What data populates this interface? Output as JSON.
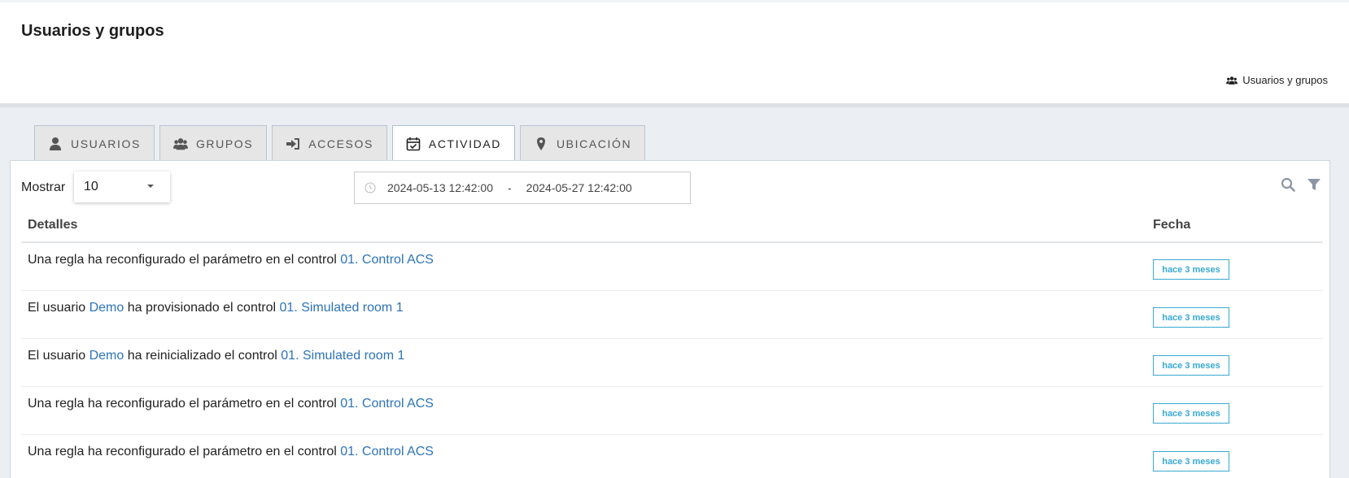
{
  "page": {
    "title": "Usuarios y grupos",
    "breadcrumb": "Usuarios y grupos"
  },
  "tabs": [
    {
      "label": "USUARIOS",
      "icon": "user-icon"
    },
    {
      "label": "GRUPOS",
      "icon": "users-icon"
    },
    {
      "label": "ACCESOS",
      "icon": "sign-in-icon"
    },
    {
      "label": "ACTIVIDAD",
      "icon": "calendar-check-icon",
      "active": true
    },
    {
      "label": "UBICACIÓN",
      "icon": "map-marker-icon"
    }
  ],
  "toolbar": {
    "show_label": "Mostrar",
    "page_size": "10",
    "date_from": "2024-05-13 12:42:00",
    "date_separator": "-",
    "date_to": "2024-05-27 12:42:00"
  },
  "table": {
    "headers": [
      "Detalles",
      "Fecha"
    ],
    "rows": [
      {
        "pre": "Una regla ha reconfigurado el parámetro en el control ",
        "user": "",
        "mid": "",
        "control": "01. Control ACS",
        "date": "hace 3 meses"
      },
      {
        "pre": "El usuario ",
        "user": "Demo",
        "mid": " ha provisionado el control ",
        "control": "01. Simulated room 1",
        "date": "hace 3 meses"
      },
      {
        "pre": "El usuario ",
        "user": "Demo",
        "mid": " ha reinicializado el control ",
        "control": "01. Simulated room 1",
        "date": "hace 3 meses"
      },
      {
        "pre": "Una regla ha reconfigurado el parámetro en el control ",
        "user": "",
        "mid": "",
        "control": "01. Control ACS",
        "date": "hace 3 meses"
      },
      {
        "pre": "Una regla ha reconfigurado el parámetro en el control ",
        "user": "",
        "mid": "",
        "control": "01. Control ACS",
        "date": "hace 3 meses"
      }
    ]
  },
  "colors": {
    "link": "#2d74b7",
    "badge": "#38a9d1",
    "background": "#ebeef2"
  }
}
